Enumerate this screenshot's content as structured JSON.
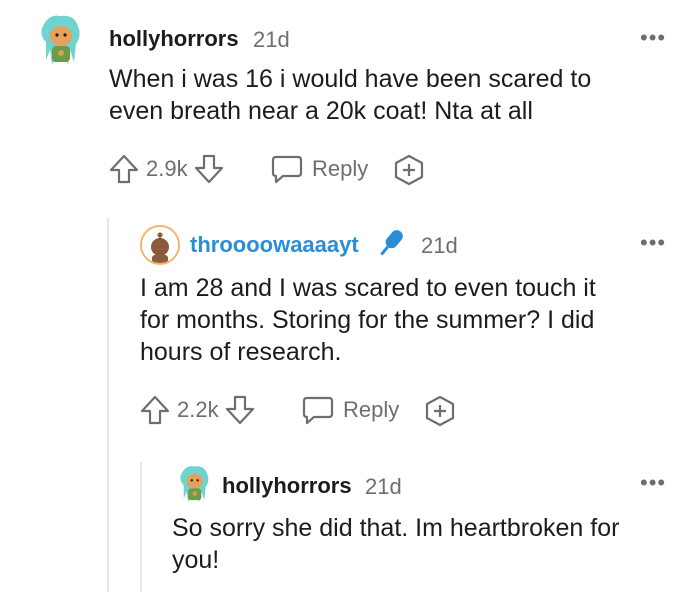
{
  "comments": [
    {
      "username": "hollyhorrors",
      "time": "21d",
      "more": "•••",
      "text_lines": [
        "When i was 16 i would have been scared to",
        "even breath near a 20k coat! Nta at all"
      ],
      "votes": "2.9k",
      "reply": "Reply"
    },
    {
      "username": "throooowaaaayt",
      "time": "21d",
      "more": "•••",
      "text_lines": [
        "I am 28 and I was scared to even touch it",
        "for months. Storing for the summer? I did",
        "hours of research."
      ],
      "votes": "2.2k",
      "reply": "Reply"
    },
    {
      "username": "hollyhorrors",
      "time": "21d",
      "more": "•••",
      "text_lines": [
        "So sorry she did that. Im heartbroken for",
        "you!"
      ]
    }
  ],
  "colors": {
    "op_username": "#2a8ed6",
    "muted": "#6b6f73",
    "thread_line": "#e4e6e8",
    "avatar_ring": "#f6b26b"
  },
  "icons": [
    "upvote-icon",
    "downvote-icon",
    "reply-bubble-icon",
    "award-icon",
    "microphone-icon",
    "more-options-icon"
  ]
}
